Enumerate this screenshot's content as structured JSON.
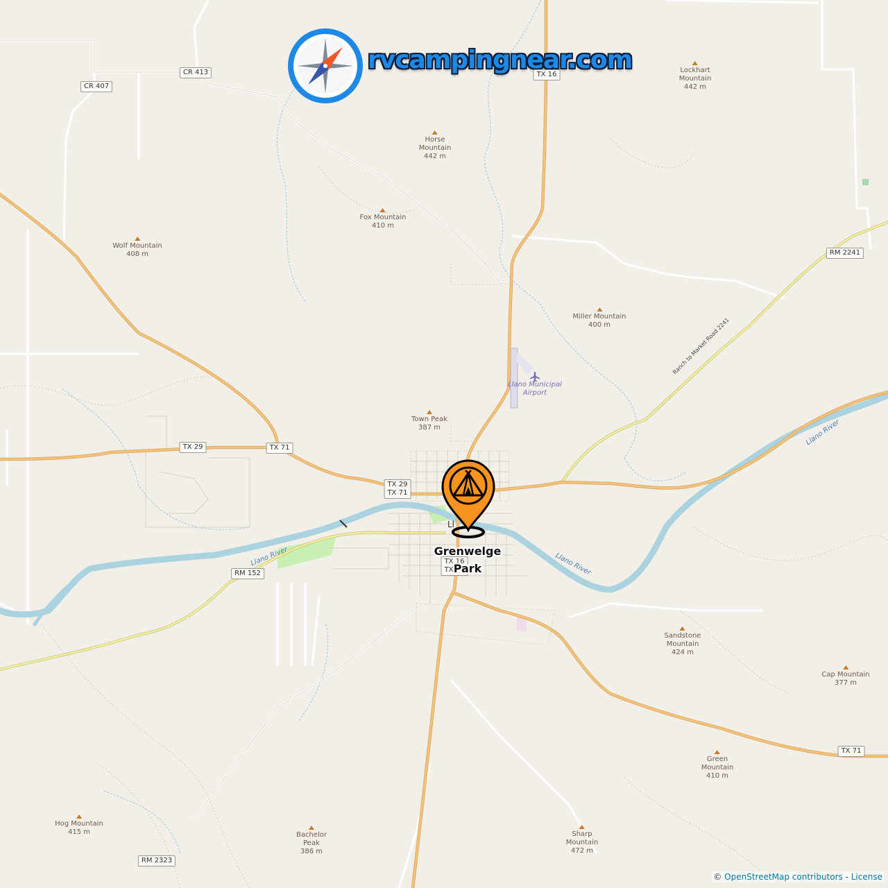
{
  "brand": {
    "site_name": "rvcampingnear.com",
    "icon": "compass-icon"
  },
  "marker": {
    "name": "Grenwelge Park",
    "icon": "campsite-tent-pin-icon",
    "color": "#f7931e"
  },
  "roads": {
    "cr407": "CR 407",
    "cr413": "CR 413",
    "tx16_north": "TX 16",
    "rm2241": "RM 2241",
    "rm2241_name": "Ranch to Market Road 2241",
    "tx29": "TX 29",
    "tx71_west": "TX 71",
    "tx29_tx71": [
      "TX 29",
      "TX 71"
    ],
    "rm152": "RM 152",
    "tx16_tx71": [
      "TX 16",
      "TX 71"
    ],
    "tx71_east": "TX 71",
    "rm2323": "RM 2323"
  },
  "peaks": [
    {
      "name": "Lockhart Mountain",
      "lines": [
        "Lockhart",
        "Mountain",
        "442 m"
      ]
    },
    {
      "name": "Horse Mountain",
      "lines": [
        "Horse",
        "Mountain",
        "442 m"
      ]
    },
    {
      "name": "Fox Mountain",
      "lines": [
        "Fox Mountain",
        "410 m"
      ]
    },
    {
      "name": "Wolf Mountain",
      "lines": [
        "Wolf Mountain",
        "408 m"
      ]
    },
    {
      "name": "Miller Mountain",
      "lines": [
        "Miller Mountain",
        "400 m"
      ]
    },
    {
      "name": "Town Peak",
      "lines": [
        "Town Peak",
        "387 m"
      ]
    },
    {
      "name": "Sandstone Mountain",
      "lines": [
        "Sandstone",
        "Mountain",
        "424 m"
      ]
    },
    {
      "name": "Cap Mountain",
      "lines": [
        "Cap Mountain",
        "377 m"
      ]
    },
    {
      "name": "Green Mountain",
      "lines": [
        "Green",
        "Mountain",
        "410 m"
      ]
    },
    {
      "name": "Hog Mountain",
      "lines": [
        "Hog Mountain",
        "415 m"
      ]
    },
    {
      "name": "Bachelor Peak",
      "lines": [
        "Bachelor",
        "Peak",
        "386 m"
      ]
    },
    {
      "name": "Sharp Mountain",
      "lines": [
        "Sharp",
        "Mountain",
        "472 m"
      ]
    }
  ],
  "water": {
    "river_label": "Llano River",
    "river_color": "#aad3df"
  },
  "airport": {
    "lines": [
      "Llano Municipal",
      "Airport"
    ],
    "icon": "airplane-icon"
  },
  "town_label_partial": "Ll",
  "attribution": {
    "prefix": "© ",
    "osm_link": "OpenStreetMap contributors",
    "separator": " - ",
    "license_link": "License"
  },
  "colors": {
    "background": "#f2efe9",
    "primary_road": "#f3c27b",
    "secondary_road": "#f1efa0",
    "minor_road": "#ffffff",
    "brand_blue": "#1e88e5"
  }
}
